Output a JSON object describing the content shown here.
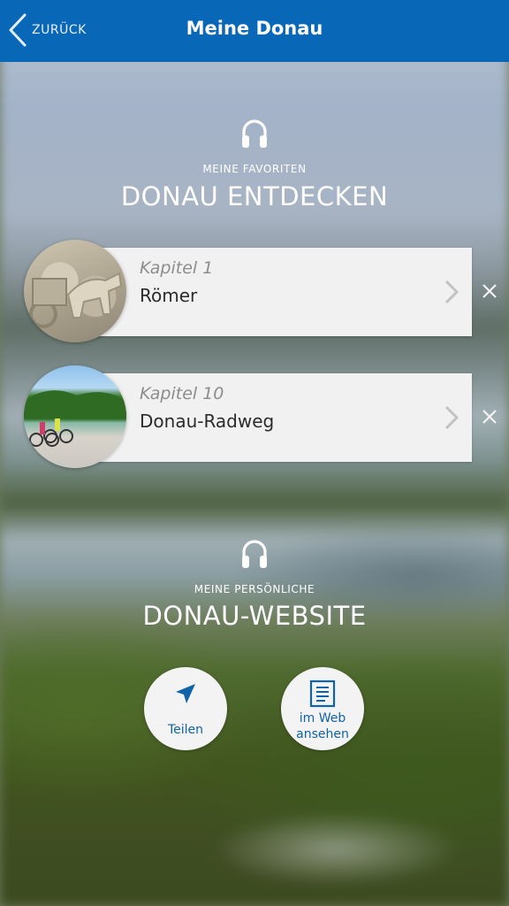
{
  "header": {
    "back_label": "ZURÜCK",
    "title": "Meine Donau"
  },
  "favorites": {
    "eyebrow": "MEINE FAVORITEN",
    "headline": "DONAU ENTDECKEN",
    "items": [
      {
        "chapter": "Kapitel 1",
        "name": "Römer"
      },
      {
        "chapter": "Kapitel 10",
        "name": "Donau-Radweg"
      }
    ]
  },
  "website": {
    "eyebrow": "MEINE PERSÖNLICHE",
    "headline": "DONAU-WEBSITE",
    "share_label": "Teilen",
    "web_label_line1": "im Web",
    "web_label_line2": "ansehen"
  },
  "colors": {
    "header_blue": "#0967b8",
    "button_text_blue": "#0f63a8"
  },
  "icons": {
    "back": "chevron-left-icon",
    "section": "headphones-icon",
    "item_arrow": "chevron-right-icon",
    "remove": "close-icon",
    "share": "send-arrow-icon",
    "web": "document-icon"
  }
}
